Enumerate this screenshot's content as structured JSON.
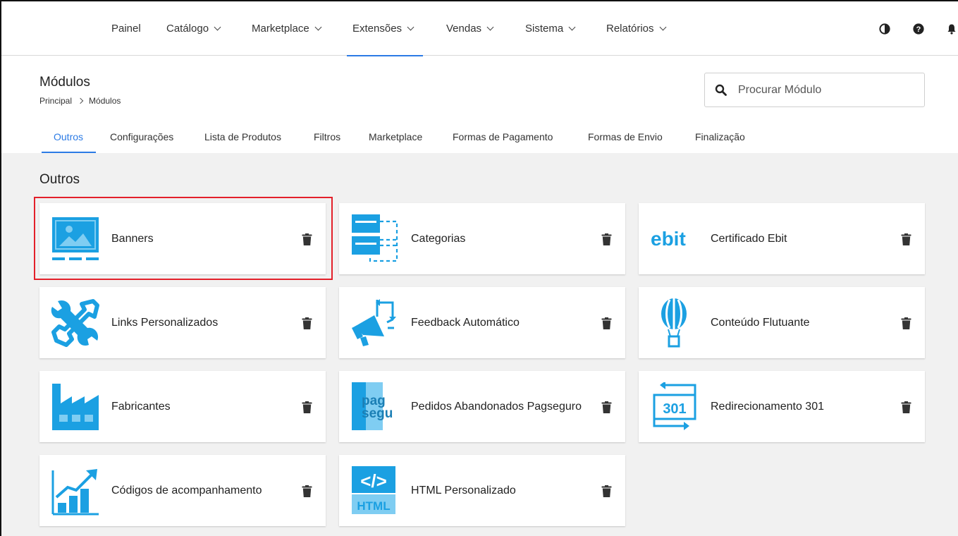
{
  "nav": {
    "items": [
      {
        "label": "Painel",
        "dropdown": false
      },
      {
        "label": "Catálogo",
        "dropdown": true
      },
      {
        "label": "Marketplace",
        "dropdown": true
      },
      {
        "label": "Extensões",
        "dropdown": true,
        "active": true
      },
      {
        "label": "Vendas",
        "dropdown": true
      },
      {
        "label": "Sistema",
        "dropdown": true
      },
      {
        "label": "Relatórios",
        "dropdown": true
      }
    ],
    "icons": [
      "contrast-icon",
      "help-icon",
      "bell-icon"
    ]
  },
  "header": {
    "title": "Módulos",
    "breadcrumb": [
      "Principal",
      "Módulos"
    ],
    "search_placeholder": "Procurar Módulo"
  },
  "tabs": [
    {
      "label": "Outros",
      "active": true
    },
    {
      "label": "Configurações"
    },
    {
      "label": "Lista de Produtos"
    },
    {
      "label": "Filtros"
    },
    {
      "label": "Marketplace"
    },
    {
      "label": "Formas de Pagamento"
    },
    {
      "label": "Formas de Envio"
    },
    {
      "label": "Finalização"
    }
  ],
  "section": {
    "title": "Outros",
    "modules": [
      {
        "name": "Banners",
        "icon": "banner-image-icon",
        "highlighted": true
      },
      {
        "name": "Categorias",
        "icon": "categories-icon"
      },
      {
        "name": "Certificado Ebit",
        "icon": "ebit-logo-icon",
        "logo_text": "ebit"
      },
      {
        "name": "Links Personalizados",
        "icon": "link-tools-icon"
      },
      {
        "name": "Feedback Automático",
        "icon": "megaphone-icon"
      },
      {
        "name": "Conteúdo Flutuante",
        "icon": "hot-air-balloon-icon"
      },
      {
        "name": "Fabricantes",
        "icon": "factory-icon"
      },
      {
        "name": "Pedidos Abandonados Pagseguro",
        "icon": "pagseguro-logo-icon",
        "logo_text": [
          "pag",
          "segu"
        ]
      },
      {
        "name": "Redirecionamento 301",
        "icon": "redirect-301-icon",
        "logo_text": "301"
      },
      {
        "name": "Códigos de acompanhamento",
        "icon": "growth-chart-icon"
      },
      {
        "name": "HTML Personalizado",
        "icon": "html-code-icon",
        "logo_text": [
          "</>",
          "HTML"
        ]
      }
    ]
  },
  "colors": {
    "accent": "#2c7be5",
    "icon_blue": "#1ba0e2",
    "icon_blue_light": "#7fcdf2",
    "highlight": "#e3202a",
    "background": "#f1f1f1"
  }
}
